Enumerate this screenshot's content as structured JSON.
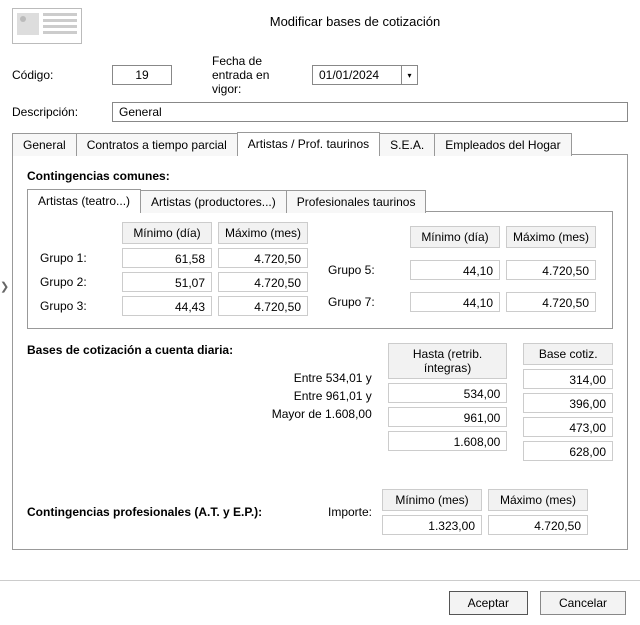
{
  "title": "Modificar bases de cotización",
  "labels": {
    "codigo": "Código:",
    "fecha": "Fecha de entrada en vigor:",
    "descripcion": "Descripción:"
  },
  "header": {
    "codigo": "19",
    "fecha": "01/01/2024",
    "descripcion": "General"
  },
  "tabs": {
    "general": "General",
    "contratos": "Contratos a tiempo parcial",
    "artistas": "Artistas / Prof. taurinos",
    "sea": "S.E.A.",
    "hogar": "Empleados del Hogar"
  },
  "section1_title": "Contingencias comunes:",
  "subtabs": {
    "teatro": "Artistas (teatro...)",
    "prod": "Artistas (productores...)",
    "taurinos": "Profesionales taurinos"
  },
  "col": {
    "min_dia": "Mínimo (día)",
    "max_mes": "Máximo (mes)"
  },
  "groups_left": [
    {
      "label": "Grupo 1:",
      "min": "61,58",
      "max": "4.720,50"
    },
    {
      "label": "Grupo 2:",
      "min": "51,07",
      "max": "4.720,50"
    },
    {
      "label": "Grupo 3:",
      "min": "44,43",
      "max": "4.720,50"
    }
  ],
  "groups_right": [
    {
      "label": "Grupo 5:",
      "min": "44,10",
      "max": "4.720,50"
    },
    {
      "label": "Grupo 7:",
      "min": "44,10",
      "max": "4.720,50"
    }
  ],
  "bc": {
    "title": "Bases de cotización a cuenta diaria:",
    "col_hasta": "Hasta (retrib. íntegras)",
    "col_base": "Base cotiz.",
    "rows": [
      {
        "label": "",
        "hasta": "534,00",
        "base": "314,00"
      },
      {
        "label": "Entre 534,01  y",
        "hasta": "961,00",
        "base": "396,00"
      },
      {
        "label": "Entre 961,01  y",
        "hasta": "1.608,00",
        "base": "473,00"
      },
      {
        "label": "Mayor de 1.608,00",
        "hasta": "",
        "base": "628,00"
      }
    ]
  },
  "cp": {
    "title": "Contingencias profesionales (A.T. y E.P.):",
    "sub": "Importe:",
    "col_min": "Mínimo (mes)",
    "col_max": "Máximo (mes)",
    "min": "1.323,00",
    "max": "4.720,50"
  },
  "buttons": {
    "ok": "Aceptar",
    "cancel": "Cancelar"
  }
}
